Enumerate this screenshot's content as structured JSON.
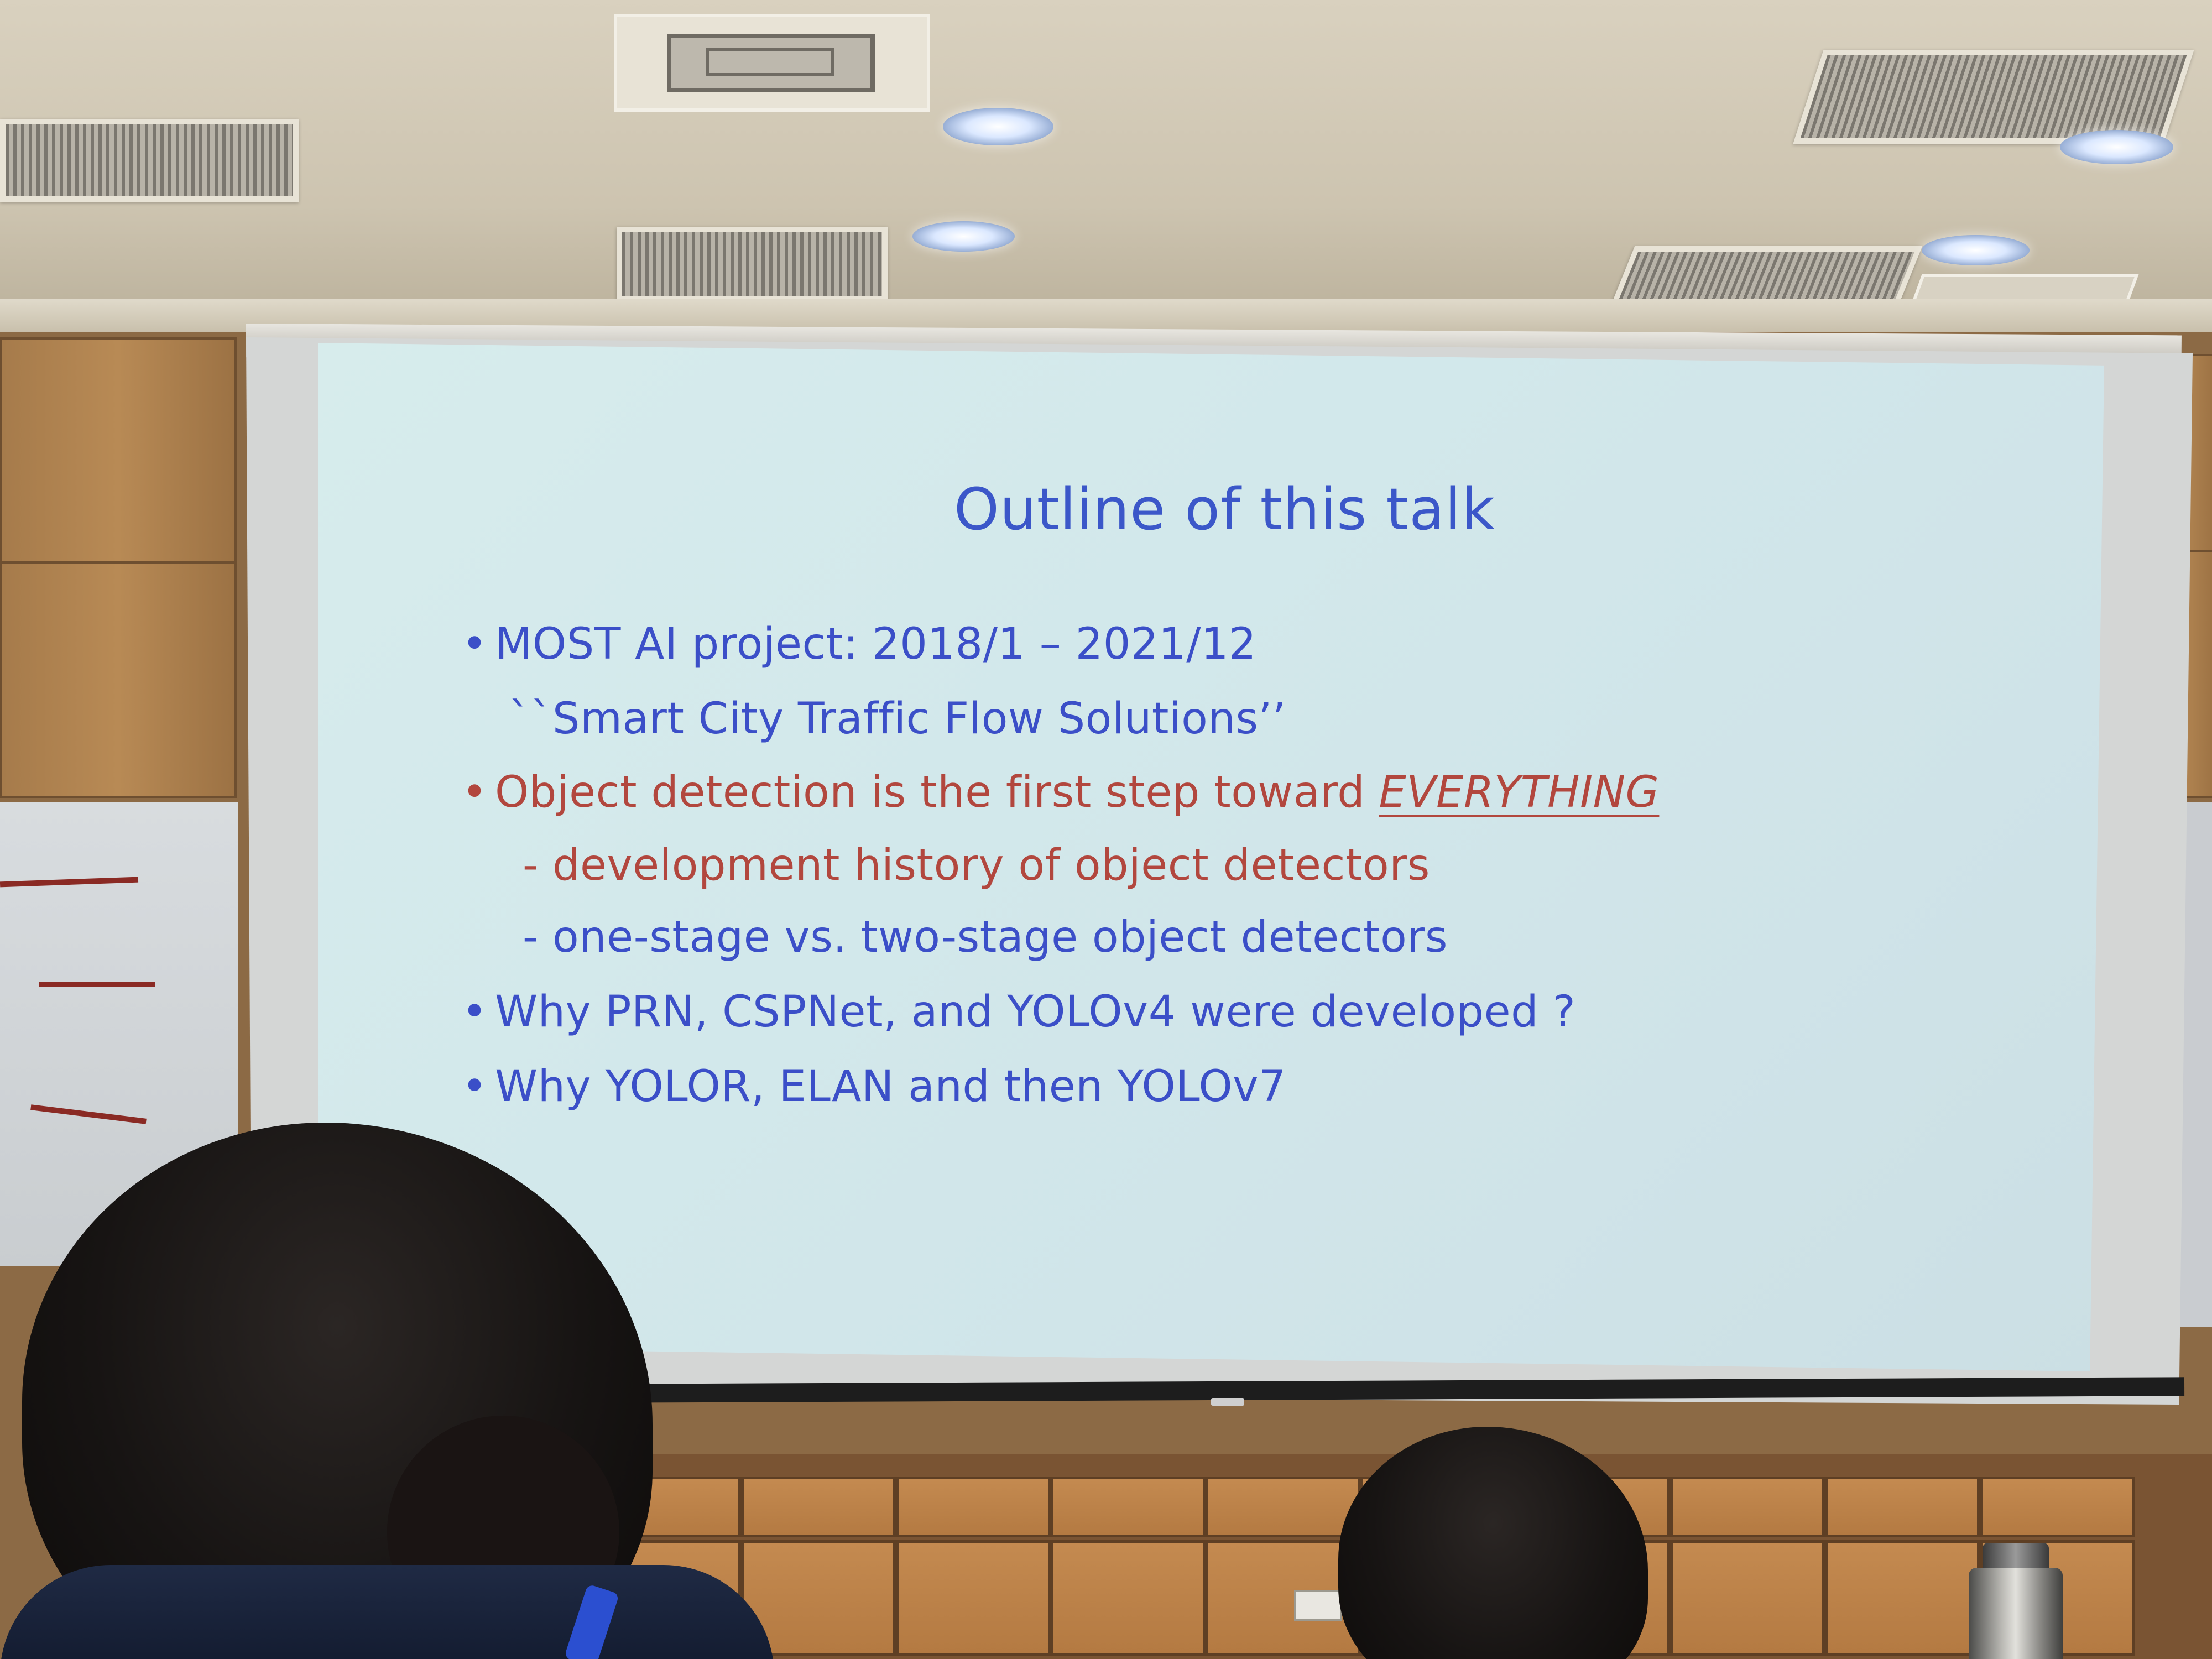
{
  "slide": {
    "title": "Outline of this talk",
    "bullets": [
      {
        "text": "MOST AI project: 2018/1 – 2021/12",
        "color": "#3b4fc8",
        "subline": "``Smart City Traffic Flow Solutions’’"
      },
      {
        "text": "Object detection is the first step toward ",
        "emphasis": "EVERYTHING",
        "color": "#b2473e",
        "subitems": [
          {
            "text": "- development history of object detectors",
            "color": "#b2473e"
          },
          {
            "text": "- one-stage vs. two-stage object detectors",
            "color": "#3b4fc8"
          }
        ]
      },
      {
        "text": "Why PRN, CSPNet, and YOLOv4 were developed ?",
        "color": "#3b4fc8"
      },
      {
        "text": "Why YOLOR, ELAN and then YOLOv7",
        "color": "#3b4fc8"
      }
    ],
    "bullet_symbol": "•"
  },
  "colors": {
    "slide_background": "#d4eaec",
    "title": "#3b57c9",
    "blue_text": "#3b4fc8",
    "red_text": "#b2473e"
  }
}
